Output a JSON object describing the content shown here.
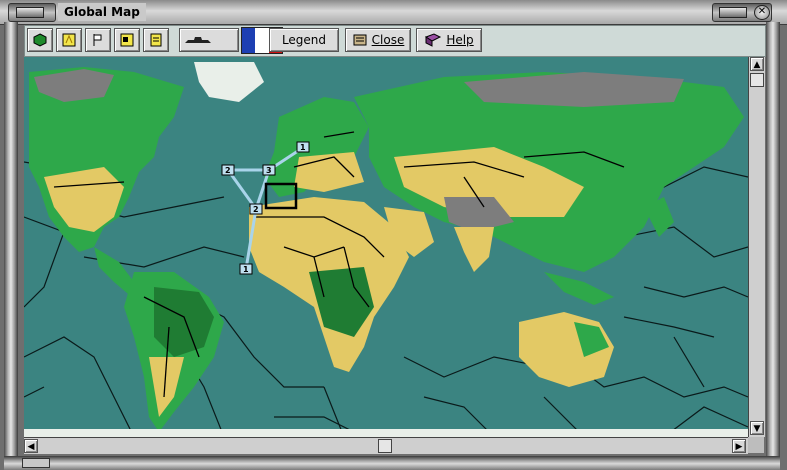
{
  "window": {
    "title": "Global Map"
  },
  "toolbar": {
    "legend_label": "Legend",
    "close_label": "Close",
    "help_label": "Help",
    "flag_colors": [
      "#1d3fb3",
      "#ffffff",
      "#d01010"
    ]
  },
  "map": {
    "route_labels": [
      "1",
      "2",
      "3",
      "2",
      "1"
    ],
    "ocean_color": "#3b8481",
    "land_colors": [
      "#e3c965",
      "#2ea84a",
      "#1f7c33",
      "#7d7d7d",
      "#e9efe9"
    ]
  },
  "icons": [
    "terrain-icon",
    "resources-icon",
    "flag-icon",
    "cities-icon",
    "list-icon",
    "unit-icon",
    "legend-book-icon",
    "close-scroll-icon",
    "help-book-icon"
  ]
}
